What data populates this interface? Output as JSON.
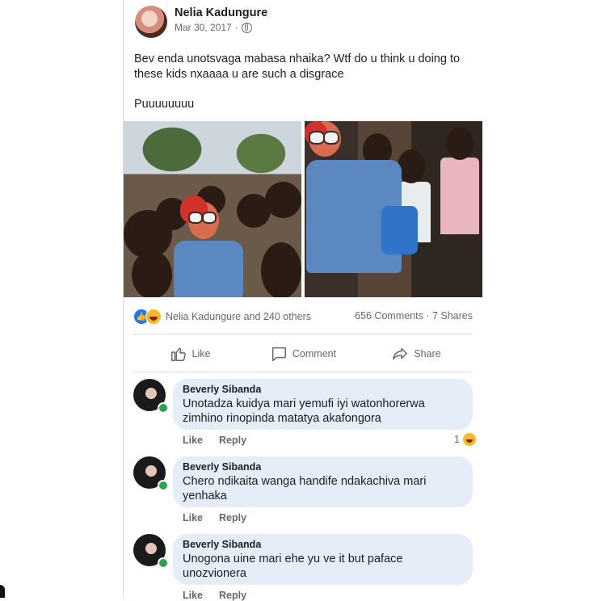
{
  "post": {
    "author": "Nelia Kadungure",
    "date": "Mar 30, 2017",
    "separator": "·",
    "privacy_icon": "globe-icon",
    "text_line1": "Bev enda unotsvaga mabasa nhaika? Wtf do u think u doing to these kids nxaaaa u are such a disgrace",
    "text_line2": "Puuuuuuuu",
    "reactions_label": "Nelia Kadungure and 240 others",
    "counts": "656 Comments · 7 Shares",
    "accent_color": "#1877f2"
  },
  "actions": {
    "like": "Like",
    "comment": "Comment",
    "share": "Share"
  },
  "comments": [
    {
      "name": "Beverly Sibanda",
      "text": "Unotadza kuidya mari yemufi iyi watonhorerwa zimhino rinopinda matatya akafongora",
      "like": "Like",
      "reply": "Reply",
      "reaction_count": "1"
    },
    {
      "name": "Beverly Sibanda",
      "text": "Chero ndikaita wanga handife ndakachiva mari yenhaka",
      "like": "Like",
      "reply": "Reply"
    },
    {
      "name": "Beverly Sibanda",
      "text": "Unogona uine mari ehe yu ve it but paface unozvionera",
      "like": "Like",
      "reply": "Reply"
    }
  ]
}
